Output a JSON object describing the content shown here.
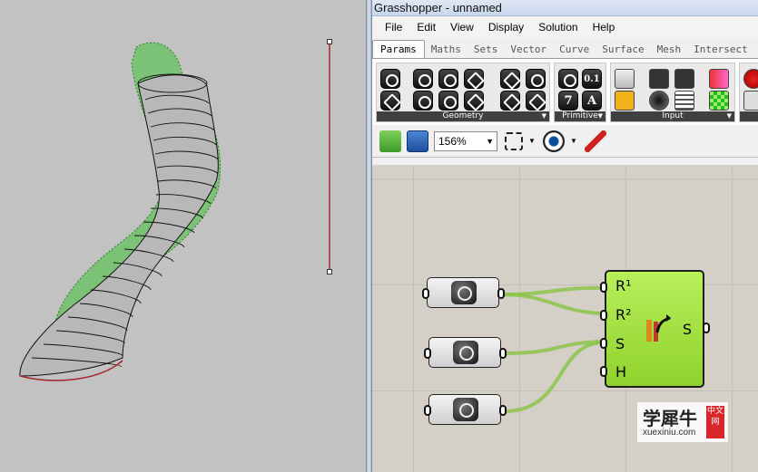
{
  "window": {
    "title": "Grasshopper - unnamed"
  },
  "menu": [
    "File",
    "Edit",
    "View",
    "Display",
    "Solution",
    "Help"
  ],
  "tabs": [
    "Params",
    "Maths",
    "Sets",
    "Vector",
    "Curve",
    "Surface",
    "Mesh",
    "Intersect"
  ],
  "ribbon": {
    "groups": [
      {
        "label": "Geometry"
      },
      {
        "label": "Primitive"
      },
      {
        "label": "Input"
      }
    ],
    "primitive_glyphs": [
      "0.1",
      "7",
      "A"
    ]
  },
  "toolbar": {
    "zoom_value": "156%"
  },
  "canvas": {
    "sweep_component": {
      "inputs": [
        "R¹",
        "R²",
        "S",
        "H"
      ],
      "output": "S"
    }
  },
  "watermark": {
    "text": "学犀牛",
    "url": "xuexiniu.com",
    "seal": "中文网"
  },
  "colors": {
    "component_green": "#9bde3a",
    "wire_green": "#8cc44a",
    "rail_red": "#a5262a"
  }
}
